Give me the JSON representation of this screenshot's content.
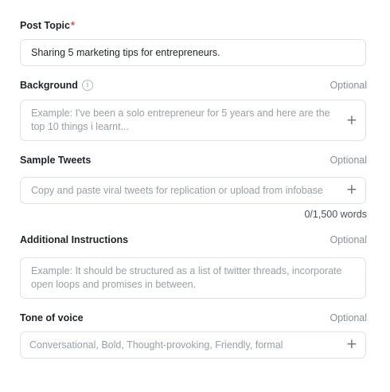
{
  "post_topic": {
    "label": "Post Topic",
    "required_mark": "*",
    "value": "Sharing 5 marketing tips for entrepreneurs."
  },
  "background": {
    "label": "Background",
    "optional": "Optional",
    "placeholder": "Example: I've been a solo entrepreneur for 5 years and here are the top 10 things i learnt...",
    "add_icon": "plus-icon",
    "info_icon": "info-icon"
  },
  "sample_tweets": {
    "label": "Sample Tweets",
    "optional": "Optional",
    "placeholder": "Copy and paste viral tweets for replication or upload from infobase",
    "add_icon": "plus-icon",
    "word_count": "0/1,500 words"
  },
  "additional_instructions": {
    "label": "Additional Instructions",
    "optional": "Optional",
    "placeholder": "Example: It should be structured as a list of twitter threads, incorporate open loops and promises in between."
  },
  "tone_of_voice": {
    "label": "Tone of voice",
    "optional": "Optional",
    "placeholder": "Conversational, Bold, Thought-provoking, Friendly, formal",
    "add_icon": "plus-icon"
  },
  "colors": {
    "required": "#e5484d",
    "border": "#dfe2e6",
    "placeholder": "#9aa0a6",
    "optional_text": "#8b9199"
  }
}
